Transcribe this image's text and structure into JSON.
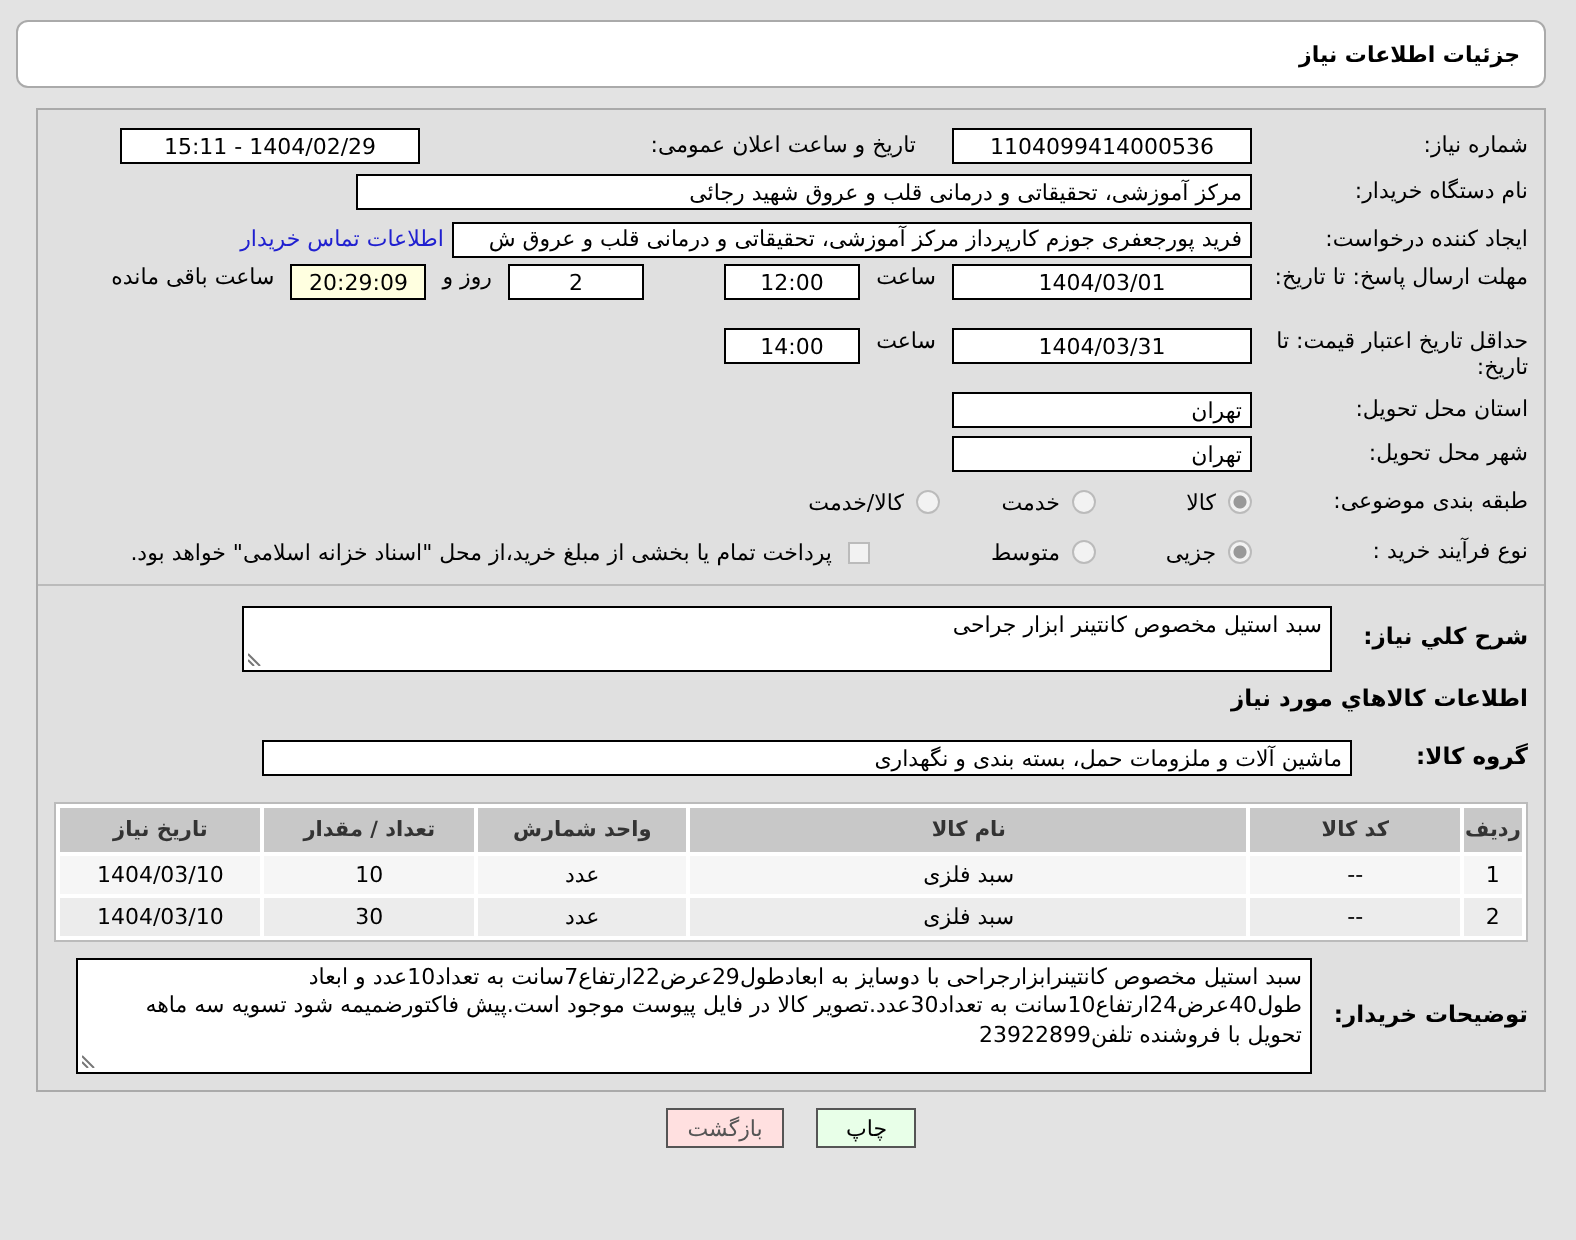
{
  "page_title": "جزئیات اطلاعات نیاز",
  "need_number": {
    "label": "شماره نیاز:",
    "value": "1104099414000536"
  },
  "announce": {
    "label": "تاریخ و ساعت اعلان عمومی:",
    "value": "1404/02/29 - 15:11"
  },
  "buyer_org": {
    "label": "نام دستگاه خریدار:",
    "value": "مرکز آموزشی، تحقیقاتی و درمانی قلب و عروق شهید رجائی"
  },
  "requester": {
    "label": "ایجاد کننده درخواست:",
    "value": "فرید پورجعفری جوزم کارپرداز  مرکز آموزشی، تحقیقاتی و درمانی قلب و عروق ش",
    "link": "اطلاعات تماس خریدار"
  },
  "deadline": {
    "label": "مهلت ارسال پاسخ: تا تاریخ:",
    "date": "1404/03/01",
    "time_label": "ساعت",
    "time": "12:00",
    "days": "2",
    "days_label": "روز و",
    "remaining": "20:29:09",
    "remaining_label": "ساعت باقی مانده"
  },
  "validity": {
    "label": "حداقل تاریخ اعتبار قیمت: تا تاریخ:",
    "date": "1404/03/31",
    "time_label": "ساعت",
    "time": "14:00"
  },
  "province": {
    "label": "استان محل تحویل:",
    "value": "تهران"
  },
  "city": {
    "label": "شهر محل تحویل:",
    "value": "تهران"
  },
  "category": {
    "label": "طبقه بندی موضوعی:",
    "options": [
      {
        "label": "کالا",
        "selected": true
      },
      {
        "label": "خدمت",
        "selected": false
      },
      {
        "label": "کالا/خدمت",
        "selected": false
      }
    ]
  },
  "purchase_type": {
    "label": "نوع فرآیند خرید :",
    "options": [
      {
        "label": "جزیی",
        "selected": true
      },
      {
        "label": "متوسط",
        "selected": false
      }
    ],
    "treasury": {
      "label": "پرداخت تمام یا بخشی از مبلغ خرید،از محل \"اسناد خزانه اسلامی\" خواهد بود.",
      "checked": false
    }
  },
  "summary": {
    "label": "شرح کلي نياز:",
    "value": "سبد استیل مخصوص کانتینر ابزار جراحی"
  },
  "goods_heading": "اطلاعات كالاهاي مورد نياز",
  "goods_group": {
    "label": "گروه کالا:",
    "value": "ماشین آلات و ملزومات حمل، بسته بندی و نگهداری"
  },
  "table": {
    "columns": [
      "ردیف",
      "کد کالا",
      "نام کالا",
      "واحد شمارش",
      "تعداد / مقدار",
      "تاریخ نیاز"
    ],
    "rows": [
      [
        "1",
        "--",
        "سبد فلزی",
        "عدد",
        "10",
        "1404/03/10"
      ],
      [
        "2",
        "--",
        "سبد فلزی",
        "عدد",
        "30",
        "1404/03/10"
      ]
    ]
  },
  "buyer_notes": {
    "label": "توضیحات خریدار:",
    "value": "سبد استیل  مخصوص کانتینرابزارجراحی با دوسایز به ابعادطول29عرض22ارتفاع7سانت به تعداد10عدد و ابعاد طول40عرض24ارتفاع10سانت به تعداد30عدد.تصویر کالا در فایل پیوست موجود است.پیش فاکتورضمیمه شود تسویه سه ماهه تحویل با فروشنده تلفن23922899"
  },
  "buttons": [
    {
      "kind": "print",
      "label": "چاپ"
    },
    {
      "kind": "back",
      "label": "بازگشت"
    }
  ]
}
